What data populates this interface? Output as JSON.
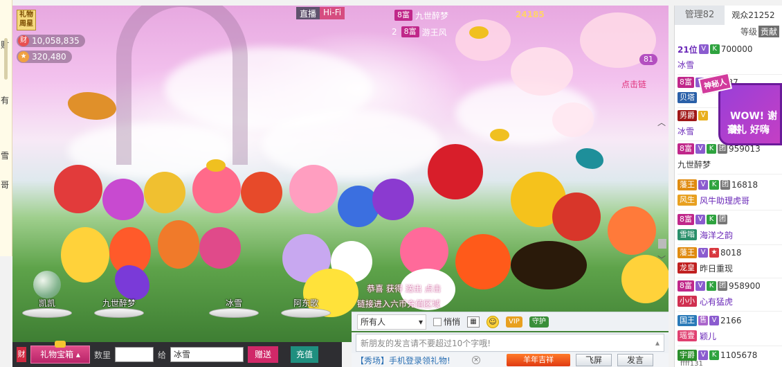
{
  "left_strip": {
    "fragments": [
      "财",
      "有",
      "雪",
      "哥"
    ]
  },
  "video": {
    "live_label": "直播",
    "hifi_label": "Hi-Fi",
    "gift_star": "礼物周星",
    "wealth_icon": "财",
    "wealth_value": "10,058,835",
    "fans_value": "320,480",
    "unread": "81",
    "click_link": "点击链",
    "rank": [
      {
        "level": "8富",
        "name": "九世醉梦",
        "score": "24185"
      },
      {
        "pos": "2",
        "level": "8富",
        "name": "游王风"
      }
    ],
    "seats": [
      "凯凯",
      "九世醉梦",
      "冰雪",
      "阿东歌"
    ],
    "marquee_1": "恭喜  获得  送出   点击",
    "marquee_2": "链接进入六币充值区域"
  },
  "chat": {
    "target": "所有人",
    "private_label": "悄悄",
    "vip_label": "VIP",
    "guard_label": "守护",
    "placeholder": "新朋友的发言请不要超过10个字哦!",
    "promo": "【秀场】手机登录领礼物!",
    "new_year": "羊年吉祥",
    "fly_screen": "飞屏",
    "send": "发言"
  },
  "gift_bar": {
    "cai": "财",
    "gift_box": "礼物宝箱",
    "qty_label": "数里",
    "to_label": "给",
    "to_value": "冰雪",
    "send": "赠送",
    "recharge": "充值"
  },
  "sidebar": {
    "tab_manage": "管理82",
    "tab_audience": "观众21252",
    "sort_label": "等级",
    "sort_active": "贡献",
    "members": [
      {
        "rank": "21位",
        "id": "700000",
        "name": "冰雪",
        "sub": ""
      },
      {
        "level": "8富",
        "id": "201937",
        "name": "",
        "sub": "贝塔"
      },
      {
        "level": "男爵",
        "id": "",
        "name": "冰雪",
        "sub": ""
      },
      {
        "level": "8富",
        "id": "959013",
        "name": "九世醉梦",
        "sub": ""
      },
      {
        "level": "藩王",
        "id": "16818",
        "name": "风牛助理虎哥",
        "sub": "风生"
      },
      {
        "level": "8富",
        "id": "",
        "name": "海洋之韵",
        "sub": "雪嗡"
      },
      {
        "level": "藩王",
        "id": "8018",
        "name": "昨日重现",
        "sub": "龙皇"
      },
      {
        "level": "8富",
        "id": "958900",
        "name": "心有猛虎",
        "sub": "小小"
      },
      {
        "level": "国王",
        "id": "2166",
        "name": "颖儿",
        "sub": "瑶壹"
      },
      {
        "level": "宇爵",
        "id": "1105678",
        "name": "",
        "sub": ""
      }
    ],
    "popup_tag": "神秘人",
    "popup_line1": "WOW! 谢谢",
    "popup_line2": "豪礼 好嗨",
    "footer": "ffff131"
  },
  "colors": {
    "accent": "#c0278a",
    "purple": "#8b5ccf",
    "green": "#2fa33f"
  }
}
